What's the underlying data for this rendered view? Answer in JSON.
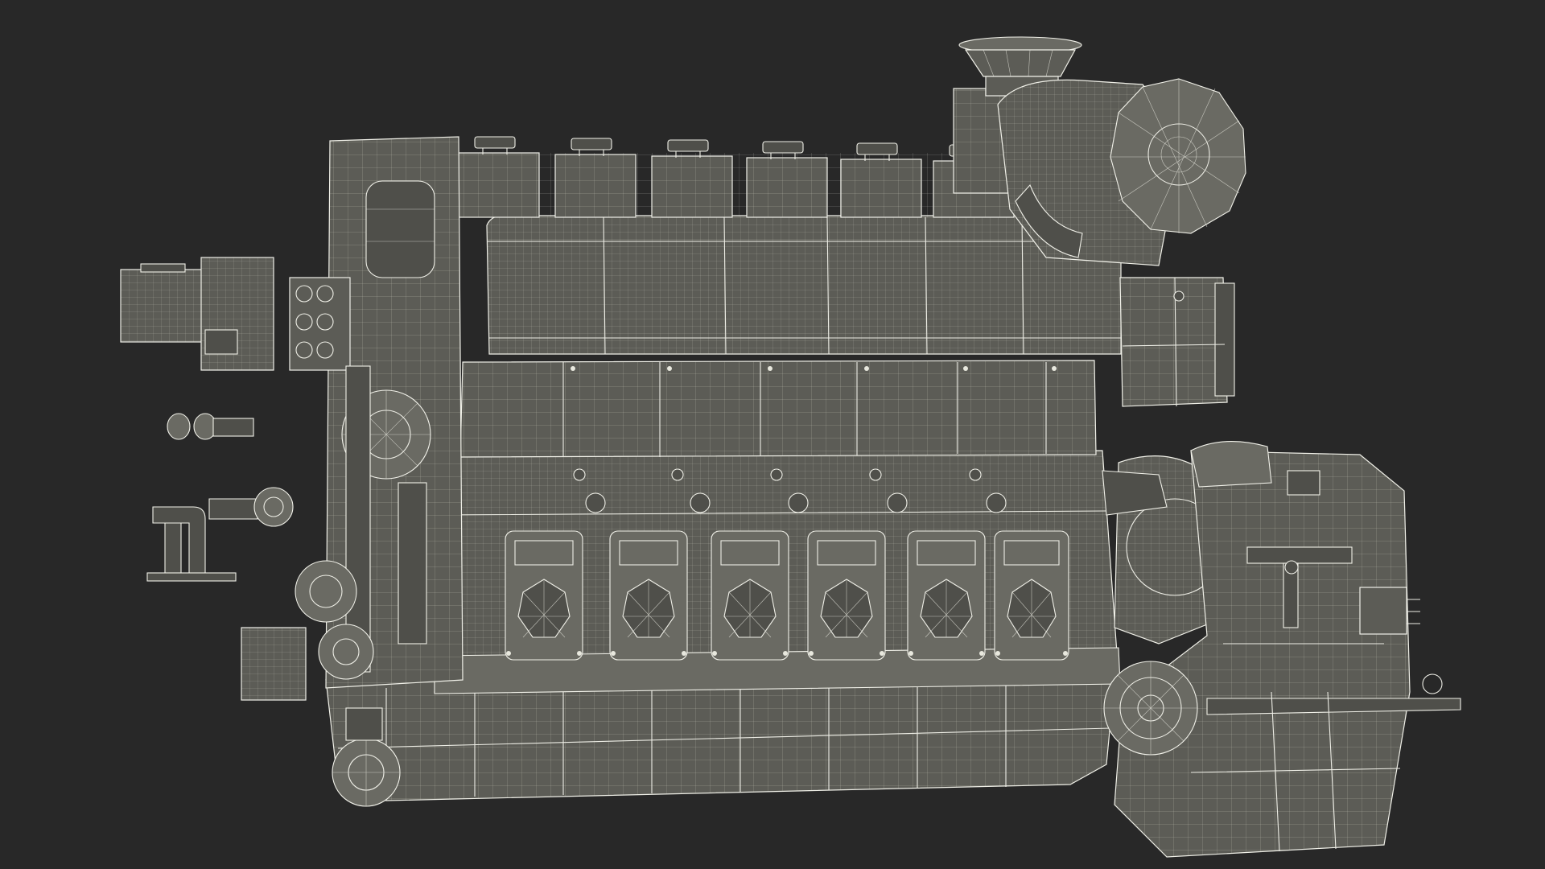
{
  "scene": {
    "background_color": "#282828",
    "model_fill_color": "#5c5c56",
    "wire_color": "#eeeee6",
    "cylinder_count": 6
  }
}
